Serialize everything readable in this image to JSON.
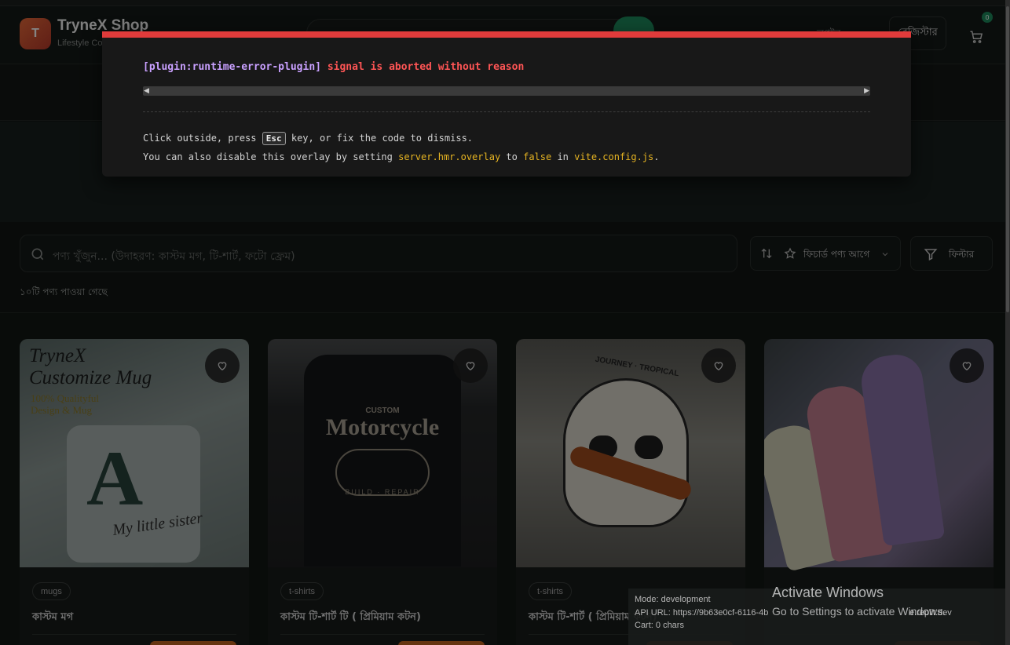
{
  "header": {
    "logo_letter": "T",
    "brand_name": "TryneX Shop",
    "brand_tagline": "Lifestyle Co",
    "user_label": "লগইন",
    "register_label": "রেজিস্টার",
    "cart_badge": "0"
  },
  "filters": {
    "search_placeholder": "পণ্য খুঁজুন... (উদাহরণ: কাস্টম মগ, টি-শার্ট, ফটো ফ্রেম)",
    "sort_label": "ফিচার্ড পণ্য আগে",
    "filter_label": "ফিল্টার",
    "result_count": "১০টি পণ্য পাওয়া গেছে"
  },
  "products": [
    {
      "category": "mugs",
      "name": "কাস্টম মগ",
      "image": {
        "title_line1": "TryneX",
        "title_line2": "Customize Mug",
        "sub_line1": "100% Qualityful",
        "sub_line2": "Design & Mug",
        "letter": "A",
        "script": "My little sister"
      }
    },
    {
      "category": "t-shirts",
      "name": "কাস্টম টি-শার্ট টি ( প্রিমিয়াম কটন)",
      "image": {
        "small": "CUSTOM",
        "big": "Motorcycle",
        "bottom": "BUILD · REPAIR"
      }
    },
    {
      "category": "t-shirts",
      "name": "কাস্টম টি-শার্ট ( প্রিমিয়াম কটন)",
      "image": {
        "caption": "JOURNEY · TROPICAL"
      }
    },
    {
      "category": "",
      "name": "",
      "image": {}
    }
  ],
  "error_overlay": {
    "plugin": "[plugin:runtime-error-plugin]",
    "message": "signal is aborted without reason",
    "tip_part1": "Click outside, press",
    "key": "Esc",
    "tip_part2": "key, or fix the code to dismiss.",
    "tip2_part1": "You can also disable this overlay by setting",
    "tip2_code1": "server.hmr.overlay",
    "tip2_part2": "to",
    "tip2_code2": "false",
    "tip2_part3": "in",
    "tip2_code3": "vite.config.js",
    "tip2_end": "."
  },
  "dev_info": {
    "mode": "Mode: development",
    "api": "API URL: https://9b63e0cf-6116-4b",
    "api_tail": "e.replit.dev",
    "cart": "Cart: 0 chars"
  },
  "windows_watermark": {
    "title": "Activate Windows",
    "subtitle": "Go to Settings to activate Windows."
  },
  "colors": {
    "error_red": "#e03b3b",
    "plugin_purple": "#c9a0ff",
    "code_yellow": "#e6b422",
    "accent_green": "#1d8a5c",
    "buy_orange": "#c4641f"
  }
}
